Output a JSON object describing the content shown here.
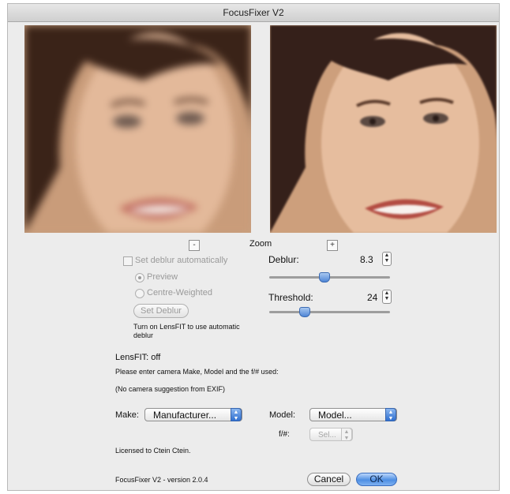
{
  "window": {
    "title": "FocusFixer V2"
  },
  "zoom": {
    "label": "Zoom",
    "minus": "-",
    "plus": "+"
  },
  "auto_deblur": {
    "checkbox_label": "Set deblur automatically",
    "preview_label": "Preview",
    "centre_weighted_label": "Centre-Weighted",
    "set_deblur_button": "Set Deblur",
    "note": "Turn on LensFIT to use automatic deblur"
  },
  "deblur": {
    "label": "Deblur:",
    "value": "8.3",
    "slider_level": 0.45
  },
  "threshold": {
    "label": "Threshold:",
    "value": "24",
    "slider_level": 0.27
  },
  "lensfit": {
    "status": "LensFIT: off",
    "prompt": "Please enter camera Make, Model and the f/# used:",
    "exif_note": "(No camera suggestion from EXIF)"
  },
  "camera": {
    "make_label": "Make:",
    "make_value": "Manufacturer...",
    "model_label": "Model:",
    "model_value": "Model...",
    "fnum_label": "f/#:",
    "fnum_value": "Sel..."
  },
  "license": "Licensed to Ctein Ctein.",
  "version": "FocusFixer V2 - version 2.0.4",
  "buttons": {
    "cancel": "Cancel",
    "ok": "OK"
  },
  "colors": {
    "accent": "#4e8fe3",
    "window_bg": "#ececec"
  }
}
